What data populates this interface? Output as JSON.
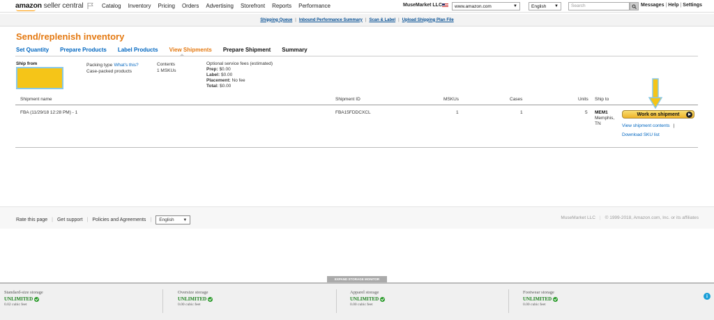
{
  "header": {
    "logo_bold": "amazon",
    "logo_light": "seller central",
    "nav": [
      "Catalog",
      "Inventory",
      "Pricing",
      "Orders",
      "Advertising",
      "Storefront",
      "Reports",
      "Performance"
    ],
    "merchant": "MuseMarket LLC",
    "marketplace": "www.amazon.com",
    "language": "English",
    "search_placeholder": "Search",
    "links": [
      "Messages",
      "Help",
      "Settings"
    ]
  },
  "subnav": [
    "Shipping Queue",
    "Inbound Performance Summary",
    "Scan & Label",
    "Upload Shipping Plan File"
  ],
  "page": {
    "title": "Send/replenish inventory",
    "steps": [
      "Set Quantity",
      "Prepare Products",
      "Label Products",
      "View Shipments",
      "Prepare Shipment",
      "Summary"
    ]
  },
  "info": {
    "ship_from_label": "Ship from",
    "packing_type_label": "Packing type",
    "whats_this": "What's this?",
    "packing_type_value": "Case-packed products",
    "contents_label": "Contents",
    "contents_value": "1 MSKUs",
    "fees_label": "Optional service fees (estimated)",
    "prep": "Prep:",
    "prep_val": "$0.00",
    "label": "Label:",
    "label_val": "$0.00",
    "placement": "Placement:",
    "placement_val": "No fee",
    "total": "Total:",
    "total_val": "$0.00"
  },
  "table": {
    "headers": [
      "Shipment name",
      "Shipment ID",
      "MSKUs",
      "Cases",
      "Units",
      "Ship to"
    ],
    "row": {
      "name": "FBA (11/29/18 12:28 PM) - 1",
      "id": "FBA15FDDCXCL",
      "mskus": "1",
      "cases": "1",
      "units": "5",
      "ship_to_code": "MEM1",
      "ship_to_city": "Memphis,",
      "ship_to_state": "TN"
    },
    "work_button": "Work on shipment",
    "view_contents": "View shipment contents",
    "download_sku": "Download SKU list"
  },
  "footer": {
    "rate": "Rate this page",
    "support": "Get support",
    "policies": "Policies and Agreements",
    "language": "English",
    "merchant": "MuseMarket LLC",
    "copyright": "© 1999-2018, Amazon.com, Inc. or its affiliates"
  },
  "storage": {
    "tab": "EXPAND STORAGE MONITOR",
    "columns": [
      {
        "name": "Standard-size storage",
        "value": "UNLIMITED",
        "sub": "0.02 cubic feet"
      },
      {
        "name": "Oversize storage",
        "value": "UNLIMITED",
        "sub": "0.00 cubic feet"
      },
      {
        "name": "Apparel storage",
        "value": "UNLIMITED",
        "sub": "0.00 cubic feet"
      },
      {
        "name": "Footwear storage",
        "value": "UNLIMITED",
        "sub": "0.00 cubic feet"
      }
    ]
  },
  "colors": {
    "accent_orange": "#e47911",
    "link_blue": "#0066c0",
    "highlight_yellow": "#f5c518",
    "arrow_blue": "#88c8e8"
  }
}
